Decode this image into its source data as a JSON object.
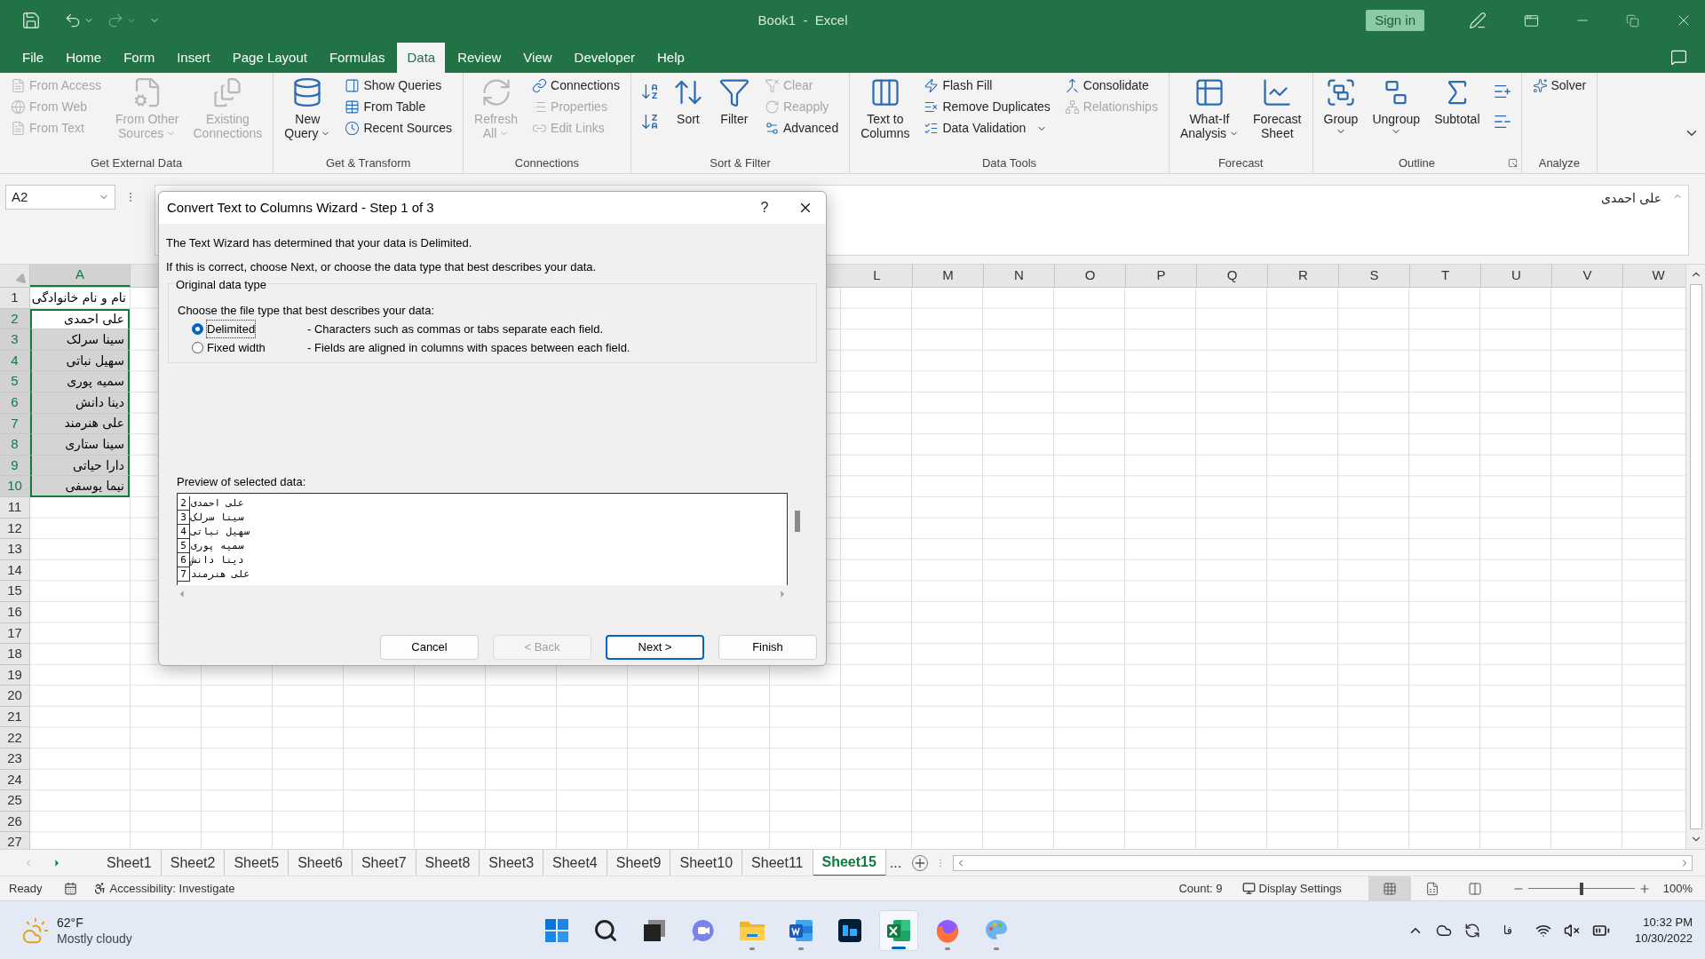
{
  "window": {
    "title": "Book1  -  Excel",
    "sign_in": "Sign in"
  },
  "tabs": [
    {
      "label": "File",
      "selected": false
    },
    {
      "label": "Home",
      "selected": false
    },
    {
      "label": "Form",
      "selected": false
    },
    {
      "label": "Insert",
      "selected": false
    },
    {
      "label": "Page Layout",
      "selected": false
    },
    {
      "label": "Formulas",
      "selected": false
    },
    {
      "label": "Data",
      "selected": true
    },
    {
      "label": "Review",
      "selected": false
    },
    {
      "label": "View",
      "selected": false
    },
    {
      "label": "Developer",
      "selected": false
    },
    {
      "label": "Help",
      "selected": false
    }
  ],
  "ribbon": [
    {
      "label": "Get External Data",
      "columns": [
        {
          "kind": "stack",
          "items": [
            {
              "label": "From Access",
              "disabled": true
            },
            {
              "label": "From Web",
              "disabled": true
            },
            {
              "label": "From Text",
              "disabled": true
            }
          ]
        },
        {
          "kind": "large",
          "lines": [
            "From Other",
            "Sources"
          ],
          "dropdown": true,
          "disabled": true
        },
        {
          "kind": "large",
          "lines": [
            "Existing",
            "Connections"
          ],
          "dropdown": false,
          "disabled": true
        }
      ]
    },
    {
      "label": "Get & Transform",
      "columns": [
        {
          "kind": "large",
          "lines": [
            "New",
            "Query"
          ],
          "dropdown": true,
          "disabled": false
        },
        {
          "kind": "stack",
          "items": [
            {
              "label": "Show Queries",
              "disabled": false
            },
            {
              "label": "From Table",
              "disabled": false
            },
            {
              "label": "Recent Sources",
              "disabled": false
            }
          ]
        }
      ]
    },
    {
      "label": "Connections",
      "columns": [
        {
          "kind": "large",
          "lines": [
            "Refresh",
            "All"
          ],
          "dropdown": true,
          "disabled": true
        },
        {
          "kind": "stack",
          "items": [
            {
              "label": "Connections",
              "disabled": false
            },
            {
              "label": "Properties",
              "disabled": true
            },
            {
              "label": "Edit Links",
              "disabled": true
            }
          ]
        }
      ]
    },
    {
      "label": "Sort & Filter",
      "columns": [
        {
          "kind": "icon_pair"
        },
        {
          "kind": "large",
          "lines": [
            "Sort"
          ],
          "dropdown": false,
          "disabled": false
        },
        {
          "kind": "large",
          "lines": [
            "Filter"
          ],
          "dropdown": false,
          "disabled": false
        },
        {
          "kind": "stack",
          "items": [
            {
              "label": "Clear",
              "disabled": true
            },
            {
              "label": "Reapply",
              "disabled": true
            },
            {
              "label": "Advanced",
              "disabled": false
            }
          ]
        }
      ]
    },
    {
      "label": "Data Tools",
      "columns": [
        {
          "kind": "large",
          "lines": [
            "Text to",
            "Columns"
          ],
          "dropdown": false,
          "disabled": false
        },
        {
          "kind": "stack",
          "items": [
            {
              "label": "Flash Fill",
              "disabled": false
            },
            {
              "label": "Remove Duplicates",
              "disabled": false
            },
            {
              "label": "Data Validation",
              "disabled": false,
              "dropdown": true
            }
          ]
        },
        {
          "kind": "stack",
          "items": [
            {
              "label": "Consolidate",
              "disabled": false
            },
            {
              "label": "Relationships",
              "disabled": true
            }
          ]
        }
      ]
    },
    {
      "label": "Forecast",
      "columns": [
        {
          "kind": "large",
          "lines": [
            "What-If",
            "Analysis"
          ],
          "dropdown": true,
          "disabled": false
        },
        {
          "kind": "large",
          "lines": [
            "Forecast",
            "Sheet"
          ],
          "dropdown": false,
          "disabled": false
        }
      ]
    },
    {
      "label": "Outline",
      "launcher": true,
      "columns": [
        {
          "kind": "large",
          "lines": [
            "Group"
          ],
          "dropdown": true,
          "disabled": false
        },
        {
          "kind": "large",
          "lines": [
            "Ungroup"
          ],
          "dropdown": true,
          "disabled": false
        },
        {
          "kind": "large",
          "lines": [
            "Subtotal"
          ],
          "dropdown": false,
          "disabled": false
        },
        {
          "kind": "icon_pair"
        }
      ]
    },
    {
      "label": "Analyze",
      "columns": [
        {
          "kind": "stack",
          "items": [
            {
              "label": "Solver",
              "disabled": false
            }
          ]
        }
      ]
    }
  ],
  "formula_bar": {
    "name_box": "A2",
    "value": "علی احمدی"
  },
  "sheet": {
    "columns": [
      {
        "label": "A",
        "selected": true
      },
      {
        "label": "L",
        "selected": false
      },
      {
        "label": "M",
        "selected": false
      },
      {
        "label": "N",
        "selected": false
      },
      {
        "label": "O",
        "selected": false
      },
      {
        "label": "P",
        "selected": false
      },
      {
        "label": "Q",
        "selected": false
      },
      {
        "label": "R",
        "selected": false
      },
      {
        "label": "S",
        "selected": false
      },
      {
        "label": "T",
        "selected": false
      },
      {
        "label": "U",
        "selected": false
      },
      {
        "label": "V",
        "selected": false
      },
      {
        "label": "W",
        "selected": false
      }
    ],
    "rows": [
      {
        "number": "1",
        "a": "نام و نام خانوادگی",
        "selected": false,
        "active": false
      },
      {
        "number": "2",
        "a": "علی احمدی",
        "selected": true,
        "active": true
      },
      {
        "number": "3",
        "a": "سینا سرلک",
        "selected": true,
        "active": false
      },
      {
        "number": "4",
        "a": "سهیل نباتی",
        "selected": true,
        "active": false
      },
      {
        "number": "5",
        "a": "سمیه پوری",
        "selected": true,
        "active": false
      },
      {
        "number": "6",
        "a": "دینا دانش",
        "selected": true,
        "active": false
      },
      {
        "number": "7",
        "a": "علی هنرمند",
        "selected": true,
        "active": false
      },
      {
        "number": "8",
        "a": "سینا ستاری",
        "selected": true,
        "active": false
      },
      {
        "number": "9",
        "a": "دارا حیاتی",
        "selected": true,
        "active": false
      },
      {
        "number": "10",
        "a": "نیما یوسفی",
        "selected": true,
        "active": false
      },
      {
        "number": "11",
        "selected": false,
        "active": false
      },
      {
        "number": "12",
        "selected": false,
        "active": false
      },
      {
        "number": "13",
        "selected": false,
        "active": false
      },
      {
        "number": "14",
        "selected": false,
        "active": false
      },
      {
        "number": "15",
        "selected": false,
        "active": false
      },
      {
        "number": "16",
        "selected": false,
        "active": false
      },
      {
        "number": "17",
        "selected": false,
        "active": false
      },
      {
        "number": "18",
        "selected": false,
        "active": false
      },
      {
        "number": "19",
        "selected": false,
        "active": false
      },
      {
        "number": "20",
        "selected": false,
        "active": false
      },
      {
        "number": "21",
        "selected": false,
        "active": false
      },
      {
        "number": "22",
        "selected": false,
        "active": false
      },
      {
        "number": "23",
        "selected": false,
        "active": false
      },
      {
        "number": "24",
        "selected": false,
        "active": false
      },
      {
        "number": "25",
        "selected": false,
        "active": false
      },
      {
        "number": "26",
        "selected": false,
        "active": false
      },
      {
        "number": "27",
        "selected": false,
        "active": false
      }
    ]
  },
  "dialog": {
    "title": "Convert Text to Columns Wizard - Step 1 of 3",
    "help": "?",
    "intro": "The Text Wizard has determined that your data is Delimited.",
    "hint": "If this is correct, choose Next, or choose the data type that best describes your data.",
    "group_title": "Original data type",
    "prompt": "Choose the file type that best describes your data:",
    "options": [
      {
        "label": "Delimited",
        "description": "- Characters such as commas or tabs separate each field.",
        "selected": true
      },
      {
        "label": "Fixed width",
        "description": "- Fields are aligned in columns with spaces between each field.",
        "selected": false
      }
    ],
    "preview_label": "Preview of selected data:",
    "preview": [
      {
        "number": "2",
        "text": "علی احمدی"
      },
      {
        "number": "3",
        "text": "سینا سرلک"
      },
      {
        "number": "4",
        "text": "سهیل نباتی"
      },
      {
        "number": "5",
        "text": "سمیه پوری"
      },
      {
        "number": "6",
        "text": "دینا دانش"
      },
      {
        "number": "7",
        "text": "علی هنرمند"
      }
    ],
    "buttons": [
      {
        "label": "Cancel",
        "disabled": false,
        "default": false
      },
      {
        "label": "< Back",
        "disabled": true,
        "default": false
      },
      {
        "label": "Next >",
        "disabled": false,
        "default": true
      },
      {
        "label": "Finish",
        "disabled": false,
        "default": false
      }
    ]
  },
  "sheet_tabs": {
    "tabs": [
      {
        "label": "Sheet1",
        "selected": false
      },
      {
        "label": "Sheet2",
        "selected": false
      },
      {
        "label": "Sheet5",
        "selected": false
      },
      {
        "label": "Sheet6",
        "selected": false
      },
      {
        "label": "Sheet7",
        "selected": false
      },
      {
        "label": "Sheet8",
        "selected": false
      },
      {
        "label": "Sheet3",
        "selected": false
      },
      {
        "label": "Sheet4",
        "selected": false
      },
      {
        "label": "Sheet9",
        "selected": false
      },
      {
        "label": "Sheet10",
        "selected": false
      },
      {
        "label": "Sheet11",
        "selected": false
      },
      {
        "label": "Sheet15",
        "selected": true
      }
    ],
    "more": "..."
  },
  "status_bar": {
    "ready": "Ready",
    "accessibility": "Accessibility: Investigate",
    "count": "Count: 9",
    "display_settings": "Display Settings",
    "views": [
      {
        "selected": true
      },
      {
        "selected": false
      },
      {
        "selected": false
      }
    ],
    "zoom": {
      "level": 0.5,
      "reading": "100%"
    }
  },
  "taskbar": {
    "weather": {
      "temp": "62°F",
      "condition": "Mostly cloudy"
    },
    "apps": [
      {
        "selected": false,
        "running": false
      },
      {
        "selected": false,
        "running": false
      },
      {
        "selected": false,
        "running": false
      },
      {
        "selected": false,
        "running": false
      },
      {
        "selected": false,
        "running": true
      },
      {
        "selected": false,
        "running": true
      },
      {
        "selected": false,
        "running": false
      },
      {
        "selected": true,
        "running": true
      },
      {
        "selected": false,
        "running": true
      },
      {
        "selected": false,
        "running": true
      }
    ],
    "language": "فا",
    "time": "10:32 PM",
    "date": "10/30/2022"
  }
}
